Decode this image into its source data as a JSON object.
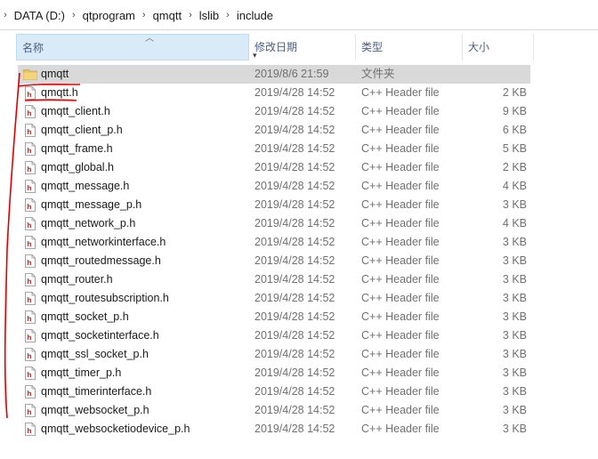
{
  "address": {
    "crumbs": [
      "DATA (D:)",
      "qtprogram",
      "qmqtt",
      "lslib",
      "include"
    ],
    "separator": "›"
  },
  "columns": {
    "name": "名称",
    "date": "修改日期",
    "type": "类型",
    "size": "大小"
  },
  "files": [
    {
      "name": "qmqtt",
      "date": "2019/8/6 21:59",
      "type": "文件夹",
      "size": "",
      "kind": "folder",
      "selected": true
    },
    {
      "name": "qmqtt.h",
      "date": "2019/4/28 14:52",
      "type": "C++ Header file",
      "size": "2 KB",
      "kind": "header"
    },
    {
      "name": "qmqtt_client.h",
      "date": "2019/4/28 14:52",
      "type": "C++ Header file",
      "size": "9 KB",
      "kind": "header"
    },
    {
      "name": "qmqtt_client_p.h",
      "date": "2019/4/28 14:52",
      "type": "C++ Header file",
      "size": "6 KB",
      "kind": "header"
    },
    {
      "name": "qmqtt_frame.h",
      "date": "2019/4/28 14:52",
      "type": "C++ Header file",
      "size": "5 KB",
      "kind": "header"
    },
    {
      "name": "qmqtt_global.h",
      "date": "2019/4/28 14:52",
      "type": "C++ Header file",
      "size": "2 KB",
      "kind": "header"
    },
    {
      "name": "qmqtt_message.h",
      "date": "2019/4/28 14:52",
      "type": "C++ Header file",
      "size": "4 KB",
      "kind": "header"
    },
    {
      "name": "qmqtt_message_p.h",
      "date": "2019/4/28 14:52",
      "type": "C++ Header file",
      "size": "3 KB",
      "kind": "header"
    },
    {
      "name": "qmqtt_network_p.h",
      "date": "2019/4/28 14:52",
      "type": "C++ Header file",
      "size": "4 KB",
      "kind": "header"
    },
    {
      "name": "qmqtt_networkinterface.h",
      "date": "2019/4/28 14:52",
      "type": "C++ Header file",
      "size": "3 KB",
      "kind": "header"
    },
    {
      "name": "qmqtt_routedmessage.h",
      "date": "2019/4/28 14:52",
      "type": "C++ Header file",
      "size": "3 KB",
      "kind": "header"
    },
    {
      "name": "qmqtt_router.h",
      "date": "2019/4/28 14:52",
      "type": "C++ Header file",
      "size": "3 KB",
      "kind": "header"
    },
    {
      "name": "qmqtt_routesubscription.h",
      "date": "2019/4/28 14:52",
      "type": "C++ Header file",
      "size": "3 KB",
      "kind": "header"
    },
    {
      "name": "qmqtt_socket_p.h",
      "date": "2019/4/28 14:52",
      "type": "C++ Header file",
      "size": "3 KB",
      "kind": "header"
    },
    {
      "name": "qmqtt_socketinterface.h",
      "date": "2019/4/28 14:52",
      "type": "C++ Header file",
      "size": "3 KB",
      "kind": "header"
    },
    {
      "name": "qmqtt_ssl_socket_p.h",
      "date": "2019/4/28 14:52",
      "type": "C++ Header file",
      "size": "3 KB",
      "kind": "header"
    },
    {
      "name": "qmqtt_timer_p.h",
      "date": "2019/4/28 14:52",
      "type": "C++ Header file",
      "size": "3 KB",
      "kind": "header"
    },
    {
      "name": "qmqtt_timerinterface.h",
      "date": "2019/4/28 14:52",
      "type": "C++ Header file",
      "size": "3 KB",
      "kind": "header"
    },
    {
      "name": "qmqtt_websocket_p.h",
      "date": "2019/4/28 14:52",
      "type": "C++ Header file",
      "size": "3 KB",
      "kind": "header"
    },
    {
      "name": "qmqtt_websocketiodevice_p.h",
      "date": "2019/4/28 14:52",
      "type": "C++ Header file",
      "size": "3 KB",
      "kind": "header"
    }
  ],
  "colors": {
    "selection": "#d9d9d9",
    "header_active": "#d9ebf9",
    "annotation": "#e00000",
    "folder": "#e8c35a"
  },
  "sort": {
    "column": "name",
    "direction": "ascending"
  }
}
